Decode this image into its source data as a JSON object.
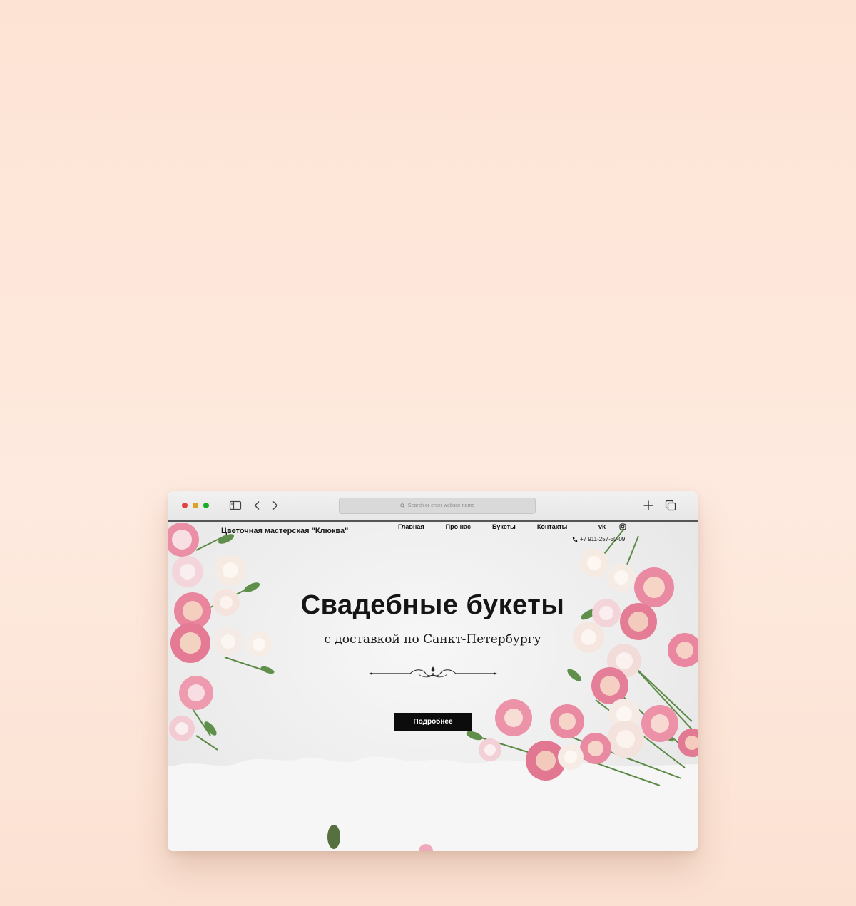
{
  "browser": {
    "address_placeholder": "Search or enter website name"
  },
  "site": {
    "brand": "Цветочная мастерская \"Клюква\"",
    "nav": [
      "Главная",
      "Про нас",
      "Букеты",
      "Контакты"
    ],
    "social": {
      "vk": "vk",
      "instagram": "instagram-icon"
    },
    "phone": "+7 911-257-50-09"
  },
  "hero": {
    "title": "Свадебные букеты",
    "subtitle": "с доставкой по Санкт-Петербургу",
    "cta_label": "Подробнее"
  },
  "colors": {
    "background": "#fde6d9",
    "button": "#0c0c0c",
    "flower_pink": "#e98aa2",
    "flower_cream": "#f6ebe1"
  }
}
